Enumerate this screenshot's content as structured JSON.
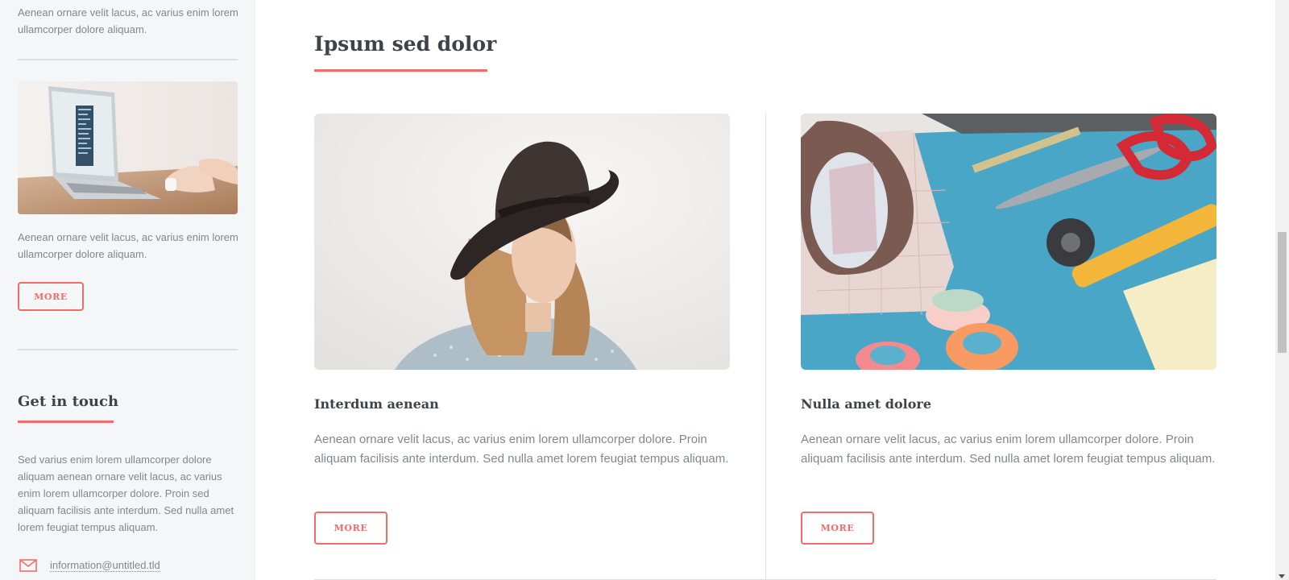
{
  "sidebar": {
    "top_text": "Aenean ornare velit lacus, ac varius enim lorem ullamcorper dolore aliquam.",
    "mini_post": {
      "image_icon": "laptop-photo",
      "text": "Aenean ornare velit lacus, ac varius enim lorem ullamcorper dolore aliquam.",
      "more_label": "MORE"
    },
    "contact": {
      "heading": "Get in touch",
      "text": "Sed varius enim lorem ullamcorper dolore aliquam aenean ornare velit lacus, ac varius enim lorem ullamcorper dolore. Proin sed aliquam facilisis ante interdum. Sed nulla amet lorem feugiat tempus aliquam.",
      "email_icon": "envelope-icon",
      "email": "information@untitled.tld"
    }
  },
  "main": {
    "heading": "Ipsum sed dolor",
    "posts": [
      {
        "image_icon": "woman-in-hat-photo",
        "title": "Interdum aenean",
        "text": "Aenean ornare velit lacus, ac varius enim lorem ullamcorper dolore. Proin aliquam facilisis ante interdum. Sed nulla amet lorem feugiat tempus aliquam.",
        "more_label": "MORE"
      },
      {
        "image_icon": "craft-tools-photo",
        "title": "Nulla amet dolore",
        "text": "Aenean ornare velit lacus, ac varius enim lorem ullamcorper dolore. Proin aliquam facilisis ante interdum. Sed nulla amet lorem feugiat tempus aliquam.",
        "more_label": "MORE"
      }
    ]
  },
  "colors": {
    "accent": "#f56a6a",
    "heading": "#3d4449",
    "body_text": "#7f888f",
    "sidebar_bg": "#f5f6f7"
  }
}
